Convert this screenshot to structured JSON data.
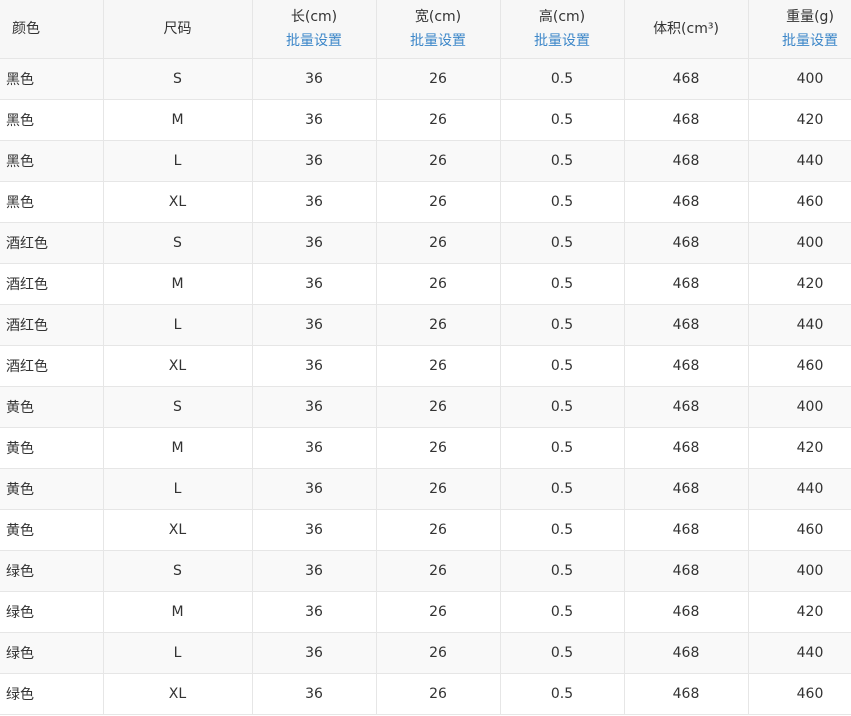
{
  "table": {
    "headers": {
      "color": "颜色",
      "size": "尺码",
      "length": "长(cm)",
      "width": "宽(cm)",
      "height": "高(cm)",
      "volume": "体积(cm³)",
      "weight": "重量(g)"
    },
    "batch_link_label": "批量设置",
    "rows": [
      [
        "黑色",
        "S",
        "36",
        "26",
        "0.5",
        "468",
        "400"
      ],
      [
        "黑色",
        "M",
        "36",
        "26",
        "0.5",
        "468",
        "420"
      ],
      [
        "黑色",
        "L",
        "36",
        "26",
        "0.5",
        "468",
        "440"
      ],
      [
        "黑色",
        "XL",
        "36",
        "26",
        "0.5",
        "468",
        "460"
      ],
      [
        "酒红色",
        "S",
        "36",
        "26",
        "0.5",
        "468",
        "400"
      ],
      [
        "酒红色",
        "M",
        "36",
        "26",
        "0.5",
        "468",
        "420"
      ],
      [
        "酒红色",
        "L",
        "36",
        "26",
        "0.5",
        "468",
        "440"
      ],
      [
        "酒红色",
        "XL",
        "36",
        "26",
        "0.5",
        "468",
        "460"
      ],
      [
        "黄色",
        "S",
        "36",
        "26",
        "0.5",
        "468",
        "400"
      ],
      [
        "黄色",
        "M",
        "36",
        "26",
        "0.5",
        "468",
        "420"
      ],
      [
        "黄色",
        "L",
        "36",
        "26",
        "0.5",
        "468",
        "440"
      ],
      [
        "黄色",
        "XL",
        "36",
        "26",
        "0.5",
        "468",
        "460"
      ],
      [
        "绿色",
        "S",
        "36",
        "26",
        "0.5",
        "468",
        "400"
      ],
      [
        "绿色",
        "M",
        "36",
        "26",
        "0.5",
        "468",
        "420"
      ],
      [
        "绿色",
        "L",
        "36",
        "26",
        "0.5",
        "468",
        "440"
      ],
      [
        "绿色",
        "XL",
        "36",
        "26",
        "0.5",
        "468",
        "460"
      ]
    ]
  },
  "colors": {
    "link": "#3d87c9",
    "border": "#e6e6e6",
    "header_bg": "#f7f7f7",
    "row_alt_bg": "#f9f9f9",
    "text": "#333333"
  }
}
